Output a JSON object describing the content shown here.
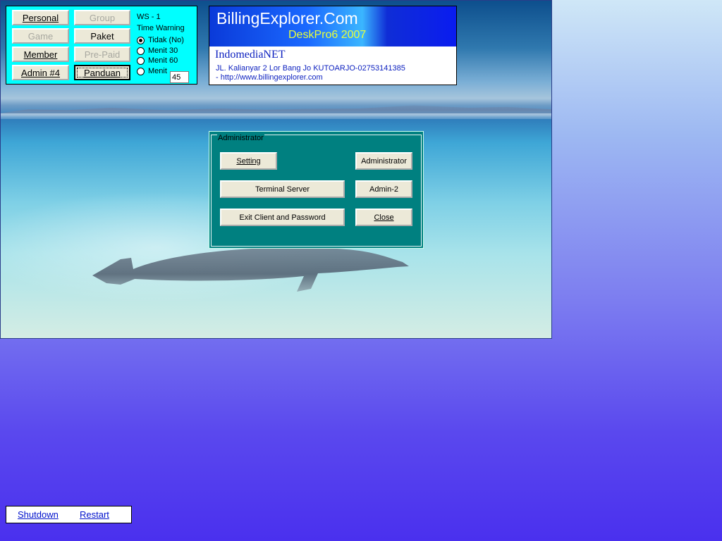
{
  "panel": {
    "buttons": {
      "personal": "Personal",
      "group": "Group",
      "game": "Game",
      "paket": "Paket",
      "member": "Member",
      "prepaid": "Pre-Paid",
      "admin4": "Admin #4",
      "panduan": "Panduan"
    },
    "ws_label": "WS - 1",
    "time_warning_label": "Time Warning",
    "radios": [
      {
        "label": "Tidak (No)",
        "checked": true
      },
      {
        "label": "Menit  30",
        "checked": false
      },
      {
        "label": "Menit  60",
        "checked": false
      },
      {
        "label": "Menit",
        "checked": false
      }
    ],
    "custom_minutes": "45"
  },
  "brand": {
    "name": "BillingExplorer.Com",
    "edition": "DeskPro6 2007",
    "company": "IndomediaNET",
    "address": "JL. Kalianyar 2 Lor Bang Jo KUTOARJO-02753141385",
    "url": "- http://www.billingexplorer.com"
  },
  "admin_dialog": {
    "group_label": "Administrator",
    "buttons": {
      "setting": "Setting",
      "administrator": "Administrator",
      "terminal_server": "Terminal Server",
      "admin2": "Admin-2",
      "exit_client": "Exit Client and Password",
      "close": "Close"
    }
  },
  "power": {
    "shutdown": "Shutdown",
    "restart": "Restart"
  },
  "colors": {
    "panel_bg": "#00FFFF",
    "dialog_bg": "#008080",
    "button_face": "#ECE9D8",
    "link": "#0011CC"
  }
}
